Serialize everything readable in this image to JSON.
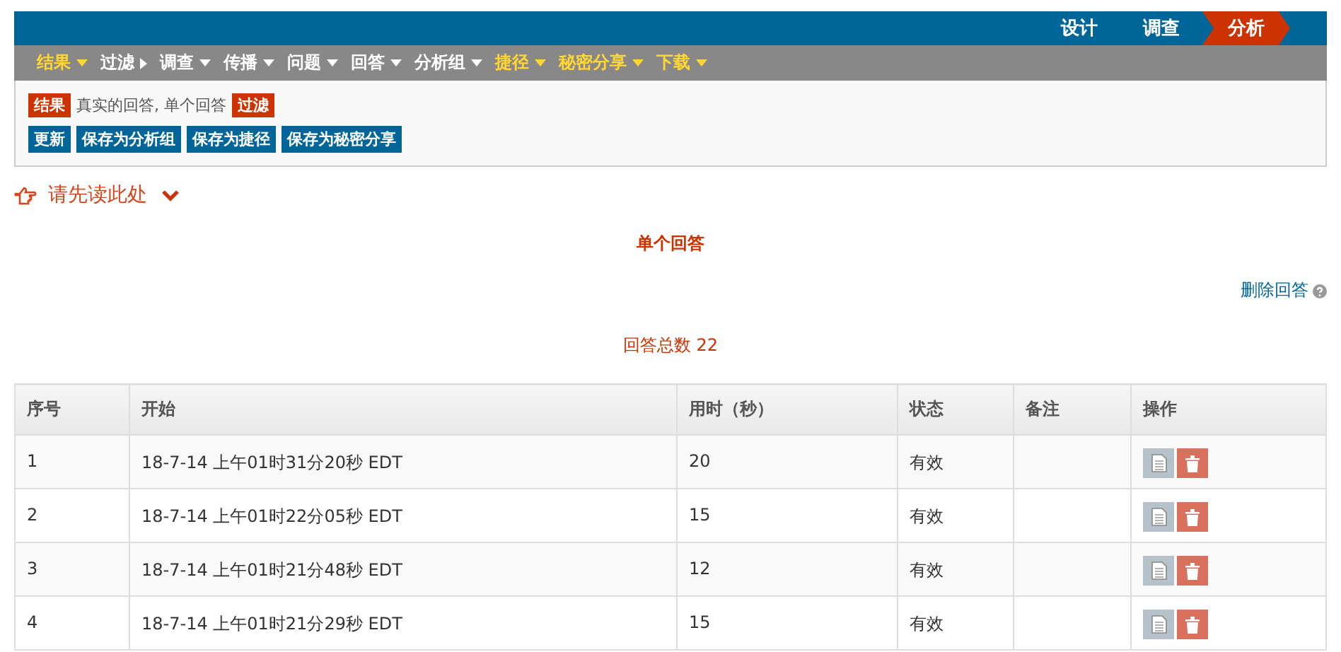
{
  "mode_tabs": [
    {
      "label": "设计",
      "selected": false
    },
    {
      "label": "调查",
      "selected": false
    },
    {
      "label": "分析",
      "selected": true
    }
  ],
  "menu": [
    {
      "label": "结果",
      "highlighted": true,
      "kind": "dropdown"
    },
    {
      "label": "过滤",
      "highlighted": false,
      "kind": "flyout"
    },
    {
      "label": "调查",
      "highlighted": false,
      "kind": "dropdown"
    },
    {
      "label": "传播",
      "highlighted": false,
      "kind": "dropdown"
    },
    {
      "label": "问题",
      "highlighted": false,
      "kind": "dropdown"
    },
    {
      "label": "回答",
      "highlighted": false,
      "kind": "dropdown"
    },
    {
      "label": "分析组",
      "highlighted": false,
      "kind": "dropdown"
    },
    {
      "label": "捷径",
      "highlighted": true,
      "kind": "dropdown"
    },
    {
      "label": "秘密分享",
      "highlighted": true,
      "kind": "dropdown"
    },
    {
      "label": "下载",
      "highlighted": true,
      "kind": "dropdown"
    }
  ],
  "filter_panel": {
    "results_tag": "结果",
    "description": "真实的回答, 单个回答",
    "filter_tag": "过滤",
    "buttons": [
      "更新",
      "保存为分析组",
      "保存为捷径",
      "保存为秘密分享"
    ]
  },
  "read_first": "请先读此处",
  "heading": "单个回答",
  "delete_link": "删除回答",
  "total": "回答总数 22",
  "table": {
    "columns": [
      "序号",
      "开始",
      "用时（秒）",
      "状态",
      "备注",
      "操作"
    ],
    "rows": [
      {
        "number": "1",
        "start": "18-7-14 上午01时31分20秒 EDT",
        "duration": "20",
        "status": "有效"
      },
      {
        "number": "2",
        "start": "18-7-14 上午01时22分05秒 EDT",
        "duration": "15",
        "status": "有效"
      },
      {
        "number": "3",
        "start": "18-7-14 上午01时21分48秒 EDT",
        "duration": "12",
        "status": "有效"
      },
      {
        "number": "4",
        "start": "18-7-14 上午01时21分29秒 EDT",
        "duration": "15",
        "status": "有效"
      }
    ]
  }
}
